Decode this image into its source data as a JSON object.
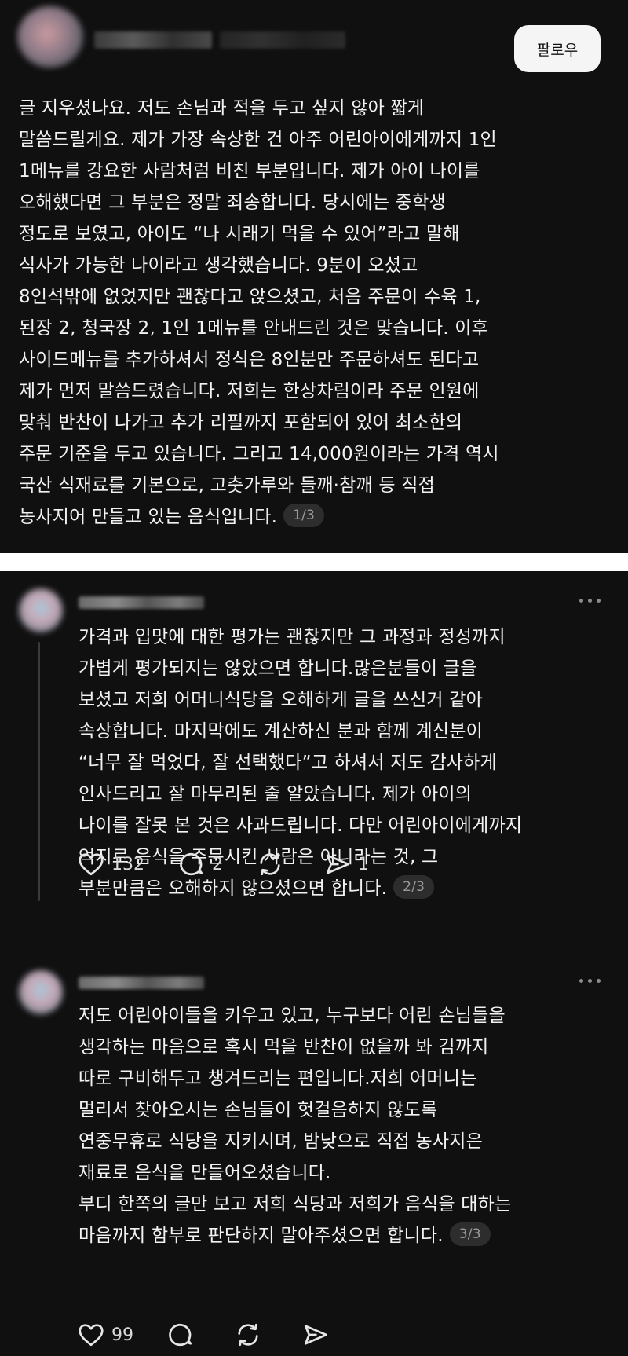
{
  "post": {
    "follow_label": "팔로우",
    "lines": [
      "글 지우셨나요. 저도 손님과 적을 두고 싶지 않아 짧게",
      "말씀드릴게요. 제가 가장 속상한 건 아주 어린아이에게까지 1인",
      "1메뉴를 강요한 사람처럼 비친 부분입니다. 제가 아이 나이를",
      "오해했다면 그 부분은 정말 죄송합니다. 당시에는 중학생",
      "정도로 보였고, 아이도 “나 시래기 먹을 수 있어”라고 말해",
      "식사가 가능한 나이라고 생각했습니다. 9분이 오셨고",
      "8인석밖에 없었지만 괜찮다고 앉으셨고, 처음 주문이 수육 1,",
      "된장 2, 청국장 2,  1인 1메뉴를 안내드린 것은 맞습니다. 이후",
      "사이드메뉴를 추가하셔서 정식은 8인분만 주문하셔도 된다고",
      "제가 먼저 말씀드렸습니다. 저희는 한상차림이라 주문 인원에",
      "맞춰 반찬이 나가고 추가 리필까지 포함되어 있어 최소한의",
      "주문 기준을 두고 있습니다. 그리고 14,000원이라는 가격 역시",
      "국산 식재료를 기본으로, 고춧가루와 들깨·참깨 등 직접",
      "농사지어 만들고 있는 음식입니다."
    ],
    "page": "1/3"
  },
  "replies": [
    {
      "lines": [
        "가격과 입맛에 대한 평가는 괜찮지만 그 과정과 정성까지",
        "가볍게 평가되지는 않았으면 합니다.많은분들이 글을",
        "보셨고 저희 어머니식당을 오해하게 글을 쓰신거 같아",
        "속상합니다. 마지막에도  계산하신 분과 함께 계신분이",
        "“너무 잘 먹었다, 잘 선택했다”고 하셔서 저도 감사하게",
        "인사드리고 잘 마무리된 줄 알았습니다. 제가 아이의",
        "나이를 잘못 본 것은 사과드립니다. 다만 어린아이에게까지",
        "억지로 음식을 주문시킨 사람은 아니라는 것, 그",
        "부분만큼은 오해하지 않으셨으면 합니다."
      ],
      "page": "2/3",
      "likes": "132",
      "comments": "2",
      "reposts": "",
      "shares": "1"
    },
    {
      "lines": [
        "저도 어린아이들을 키우고 있고, 누구보다 어린 손님들을",
        "생각하는 마음으로 혹시 먹을 반찬이 없을까 봐 김까지",
        "따로 구비해두고 챙겨드리는 편입니다.저희 어머니는",
        "멀리서 찾아오시는 손님들이 헛걸음하지 않도록",
        "연중무휴로 식당을 지키시며, 밤낮으로 직접 농사지은",
        "재료로 음식을 만들어오셨습니다.",
        "부디 한쪽의 글만 보고 저희 식당과 저희가 음식을 대하는",
        "마음까지 함부로 판단하지 말아주셨으면 합니다."
      ],
      "page": "3/3",
      "likes": "99",
      "comments": "",
      "reposts": "",
      "shares": ""
    }
  ],
  "icons": {
    "like": "heart-icon",
    "comment": "comment-bubble-icon",
    "repost": "repost-icon",
    "share": "send-icon",
    "more": "more-options-icon"
  }
}
